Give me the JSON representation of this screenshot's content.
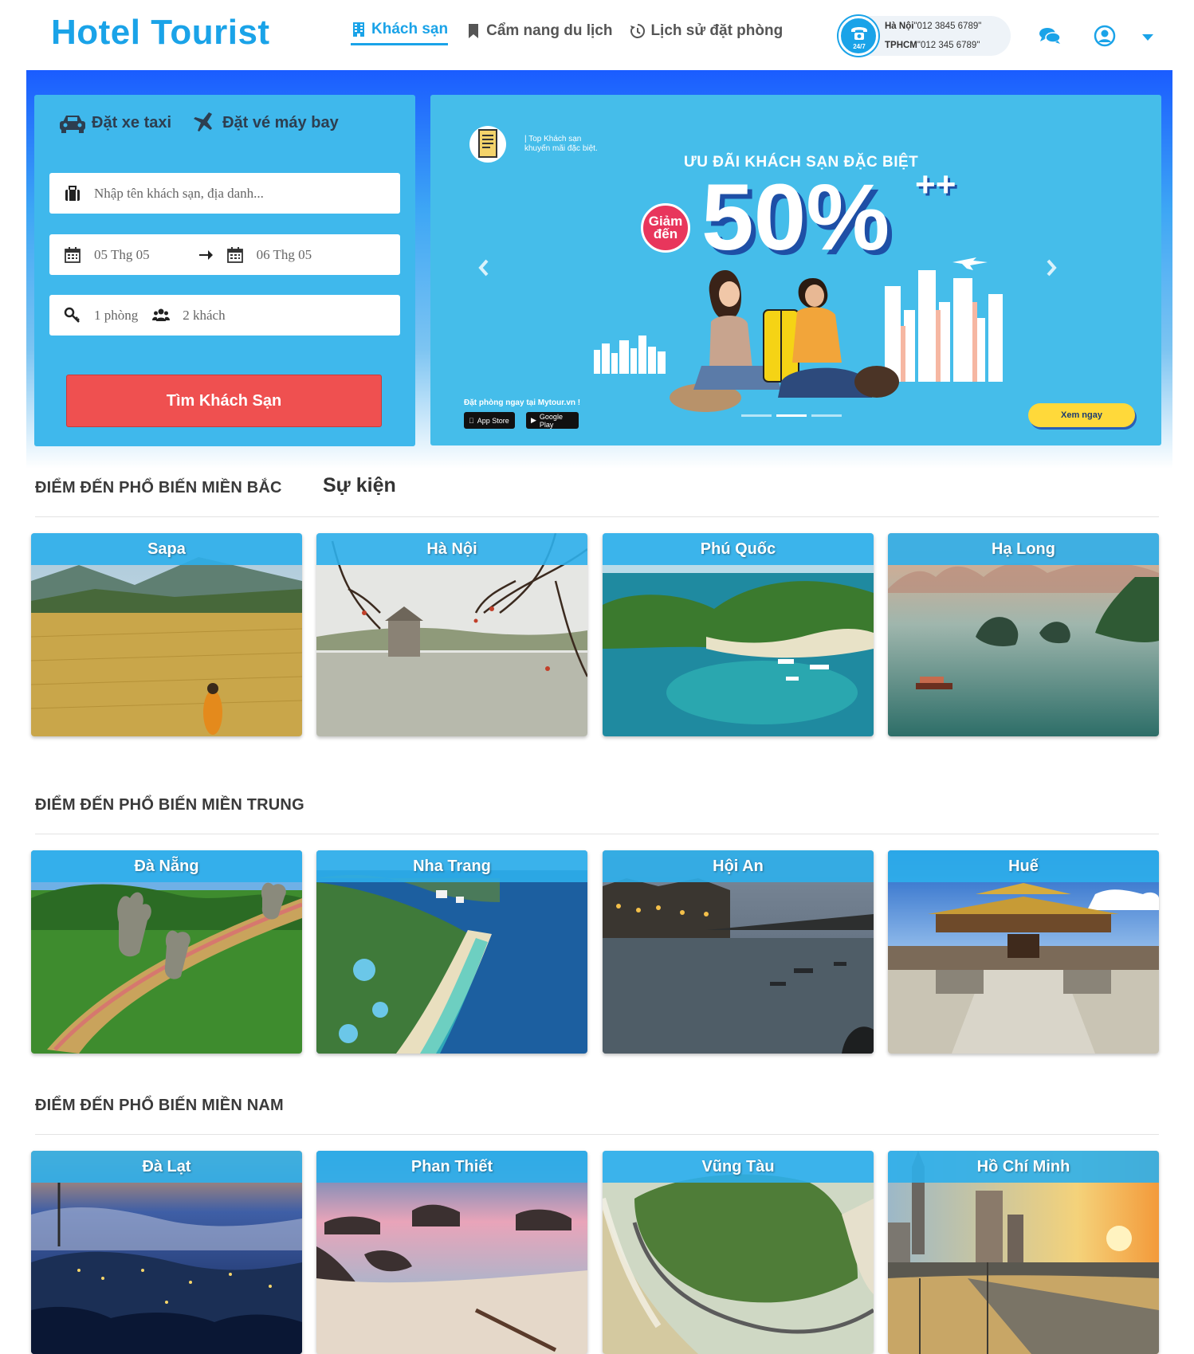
{
  "header": {
    "logo": "Hotel Tourist",
    "nav": [
      {
        "label": "Khách sạn",
        "icon": "building-icon",
        "active": true
      },
      {
        "label": "Cẩm nang du lịch",
        "icon": "bookmark-icon",
        "active": false
      },
      {
        "label": "Lịch sử đặt phòng",
        "icon": "history-icon",
        "active": false
      }
    ],
    "hotline": {
      "badge": "24/7",
      "hanoi_city": "Hà Nội",
      "hanoi_phone": "\"012 3845 6789\"",
      "hcm_city": "TPHCM",
      "hcm_phone": "\"012 345 6789\""
    }
  },
  "search": {
    "tab_taxi": "Đặt xe taxi",
    "tab_flight": "Đặt vé máy bay",
    "destination_placeholder": "Nhập tên khách sạn, địa danh...",
    "checkin": "05 Thg 05",
    "checkout": "06 Thg 05",
    "rooms": "1 phòng",
    "guests": "2 khách",
    "button": "Tìm Khách Sạn"
  },
  "banner": {
    "tag_line1": "| Top Khách sạn",
    "tag_line2": "khuyến mãi đặc biệt.",
    "title": "ƯU ĐÃI KHÁCH SẠN ĐẶC BIỆT",
    "discount": "50%",
    "plus": "++",
    "badge_line1": "Giảm",
    "badge_line2": "đến",
    "book_text": "Đặt phòng ngay tại Mytour.vn !",
    "appstore": "App Store",
    "googleplay": "Google Play",
    "cta": "Xem ngay",
    "slide_count": 3,
    "active_slide": 2
  },
  "sections": {
    "north_title": "ĐIỂM ĐẾN PHỔ BIẾN MIỀN BẮC",
    "events_tab": "Sự kiện",
    "central_title": "ĐIỂM ĐẾN PHỔ BIẾN MIỀN TRUNG",
    "south_title": "ĐIỂM ĐẾN PHỔ BIẾN MIỀN NAM"
  },
  "destinations": {
    "north": [
      "Sapa",
      "Hà Nội",
      "Phú Quốc",
      "Hạ Long"
    ],
    "central": [
      "Đà Nẵng",
      "Nha Trang",
      "Hội An",
      "Huế"
    ],
    "south": [
      "Đà Lạt",
      "Phan Thiết",
      "Vũng Tàu",
      "Hồ Chí Minh"
    ]
  },
  "colors": {
    "brand": "#1aa3e8",
    "search_panel": "#3fb8ec",
    "search_button": "#ef5050",
    "card_caption": "#2dafeb"
  }
}
